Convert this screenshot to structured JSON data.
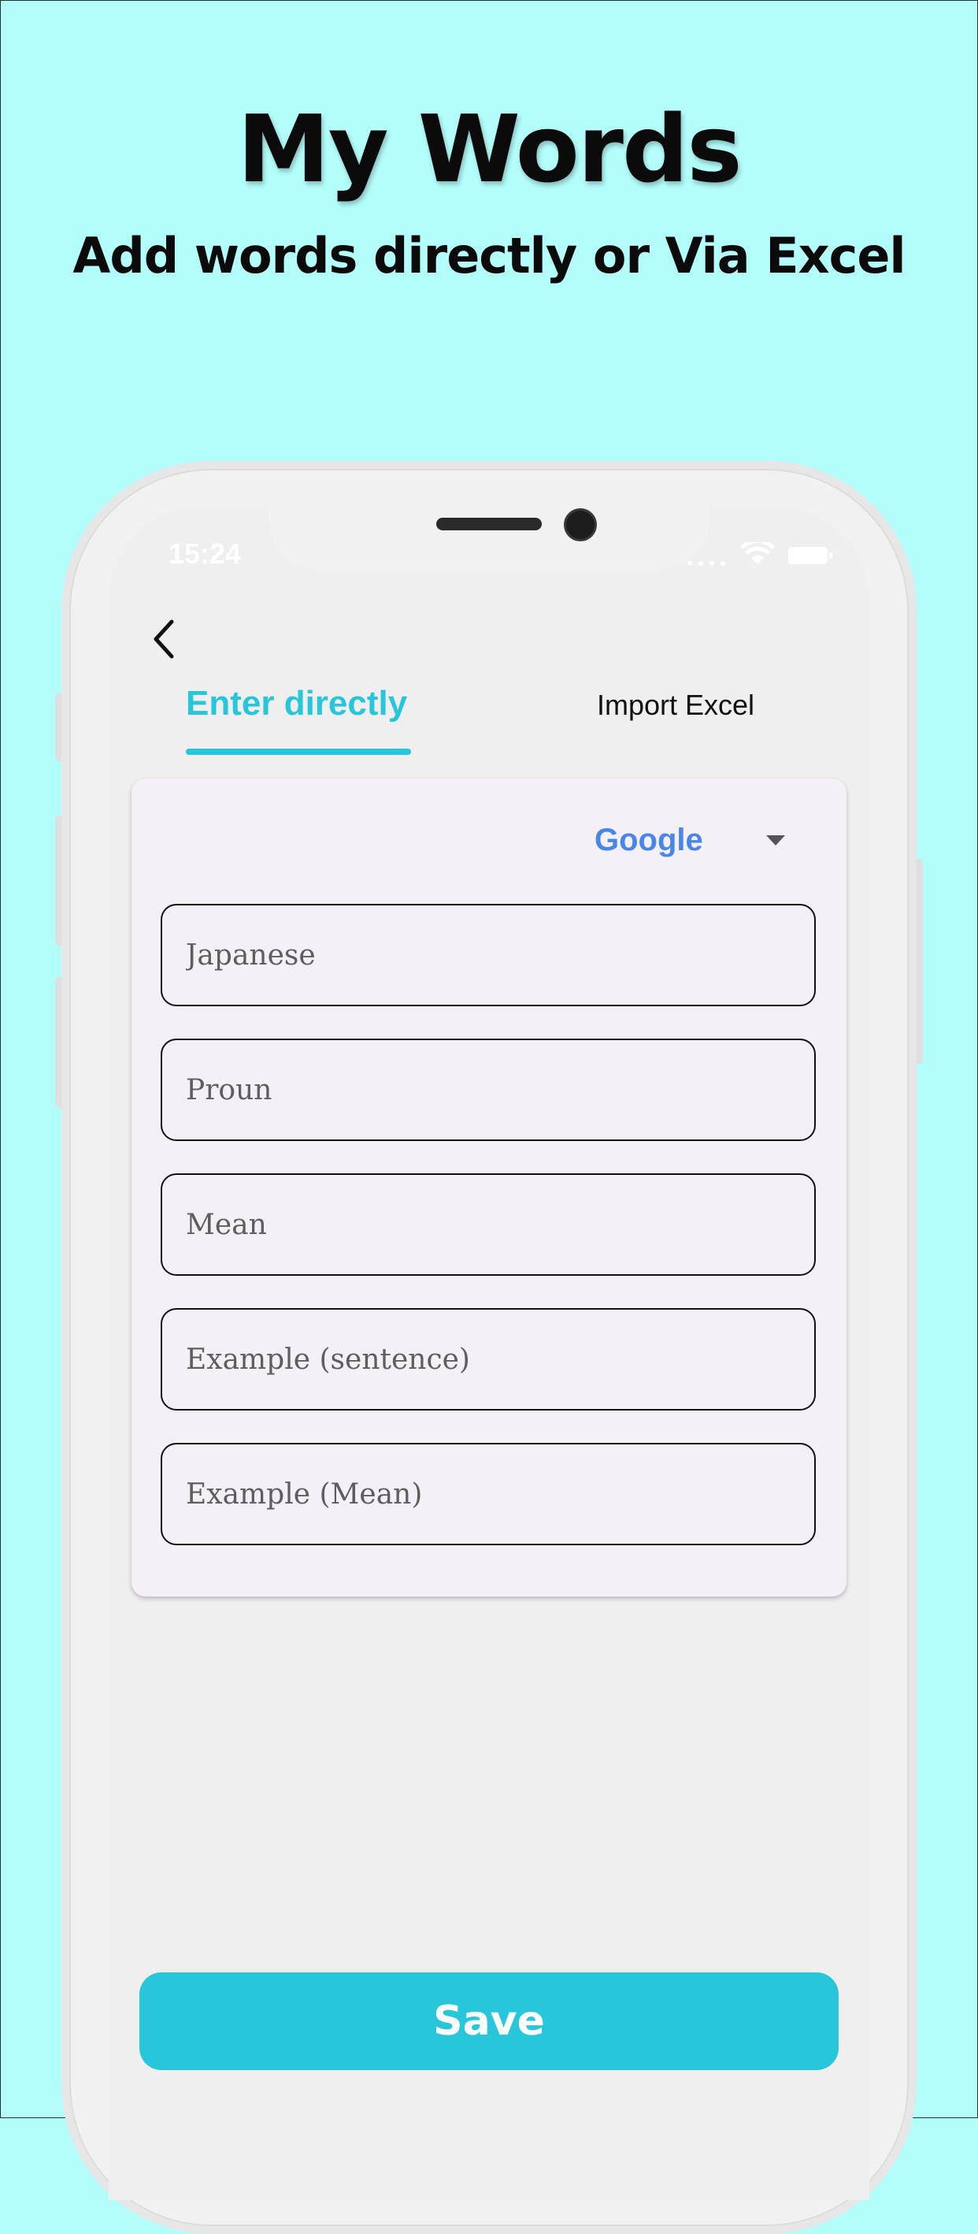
{
  "promo": {
    "headline": "My Words",
    "subline": "Add words directly or Via  Excel"
  },
  "status_bar": {
    "time": "15:24",
    "icons": [
      "wifi-icon",
      "battery-icon"
    ]
  },
  "nav": {
    "back_icon": "chevron-left-icon"
  },
  "tabs": [
    {
      "label": "Enter directly",
      "active": true
    },
    {
      "label": "Import Excel",
      "active": false
    }
  ],
  "form": {
    "provider": {
      "selected": "Google"
    },
    "fields": [
      {
        "placeholder": "Japanese",
        "value": ""
      },
      {
        "placeholder": "Proun",
        "value": ""
      },
      {
        "placeholder": "Mean",
        "value": ""
      },
      {
        "placeholder": "Example (sentence)",
        "value": ""
      },
      {
        "placeholder": "Example (Mean)",
        "value": ""
      }
    ]
  },
  "actions": {
    "save_label": "Save"
  },
  "colors": {
    "background": "#b3fdfb",
    "accent": "#27c6da",
    "google_blue": "#4a86e8",
    "card": "#f5f0f7"
  }
}
